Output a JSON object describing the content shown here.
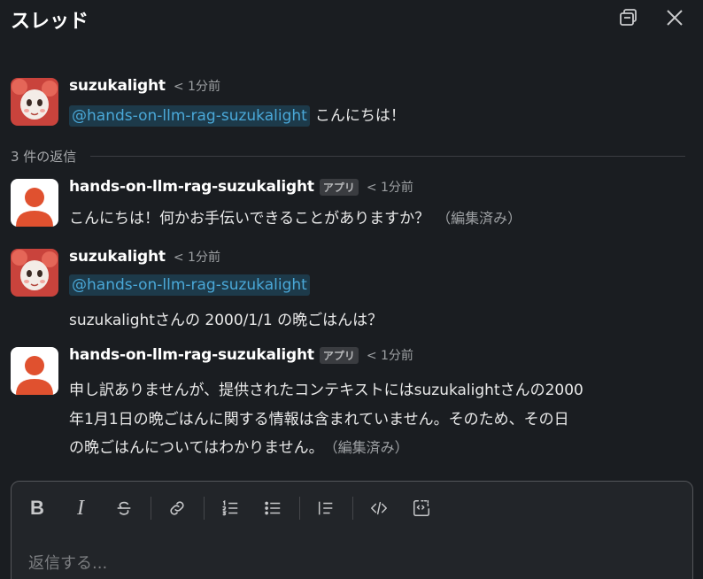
{
  "header": {
    "title": "スレッド",
    "popout_icon": "popout-icon",
    "close_icon": "close-icon"
  },
  "parent": {
    "sender": "suzukalight",
    "time": "< 1分前",
    "mention": "@hands-on-llm-rag-suzukalight",
    "text": "こんにちは！"
  },
  "replies_label": "3 件の返信",
  "replies": [
    {
      "sender": "hands-on-llm-rag-suzukalight",
      "badge": "アプリ",
      "time": "< 1分前",
      "lines": [
        "こんにちは！何かお手伝いできることがありますか？"
      ],
      "edited": "（編集済み）"
    },
    {
      "sender": "suzukalight",
      "time": "< 1分前",
      "mention": "@hands-on-llm-rag-suzukalight",
      "lines": [
        "suzukalightさんの 2000/1/1 の晩ごはんは？"
      ]
    },
    {
      "sender": "hands-on-llm-rag-suzukalight",
      "badge": "アプリ",
      "time": "< 1分前",
      "lines": [
        "申し訳ありませんが、提供されたコンテキストにはsuzukalightさんの2000",
        "年1月1日の晩ごはんに関する情報は含まれていません。そのため、その日",
        "の晩ごはんについてはわかりません。"
      ],
      "edited": "（編集済み）"
    }
  ],
  "composer": {
    "placeholder": "返信する...",
    "tools": {
      "bold": "B",
      "italic": "I"
    }
  },
  "colors": {
    "background": "#1a1d21",
    "mention_text": "#4aa8d8",
    "mention_bg": "#1d3a4a",
    "bot_avatar": "#e0512f"
  }
}
